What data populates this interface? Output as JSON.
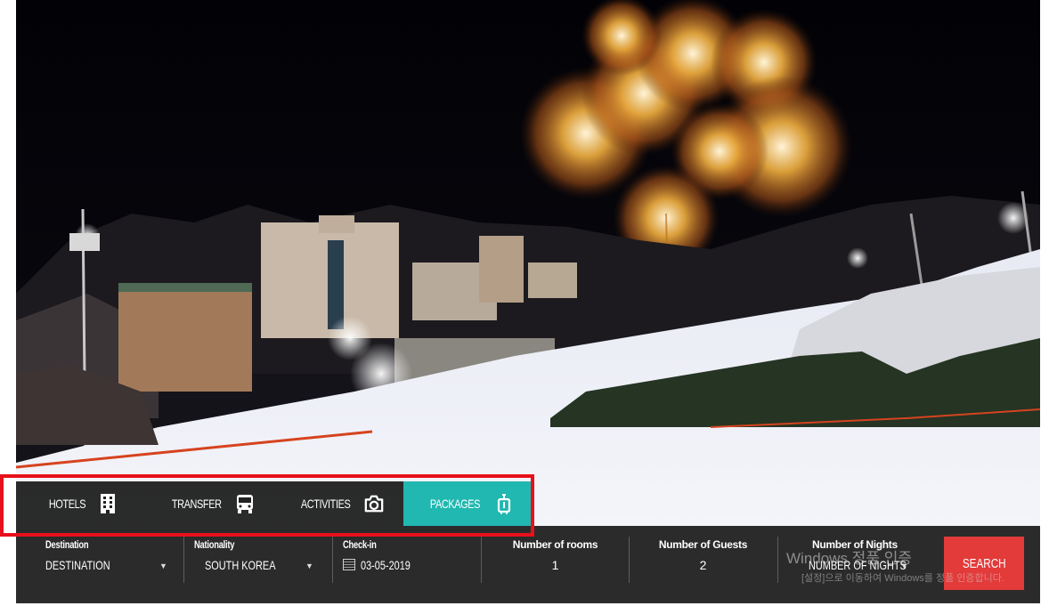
{
  "tabs": [
    {
      "label": "HOTELS",
      "icon": "hotel-icon",
      "active": false
    },
    {
      "label": "TRANSFER",
      "icon": "bus-icon",
      "active": false
    },
    {
      "label": "ACTIVITIES",
      "icon": "camera-icon",
      "active": false
    },
    {
      "label": "PACKAGES",
      "icon": "luggage-icon",
      "active": true
    }
  ],
  "search": {
    "destination": {
      "label": "Destination",
      "value": "DESTINATION"
    },
    "nationality": {
      "label": "Nationality",
      "value": "SOUTH KOREA"
    },
    "checkin": {
      "label": "Check-in",
      "value": "03-05-2019"
    },
    "rooms": {
      "label": "Number of rooms",
      "value": "1"
    },
    "guests": {
      "label": "Number of Guests",
      "value": "2"
    },
    "nights": {
      "label": "Number of Nights",
      "value": "NUMBER OF NIGHTS"
    },
    "button": "SEARCH"
  },
  "watermark": {
    "line1": "Windows 정품 인증",
    "line2": "[설정]으로 이동하여 Windows를 정품 인증합니다."
  },
  "colors": {
    "accent": "#20b8b0",
    "search": "#e33a3a",
    "highlight_frame": "#e8101a"
  }
}
